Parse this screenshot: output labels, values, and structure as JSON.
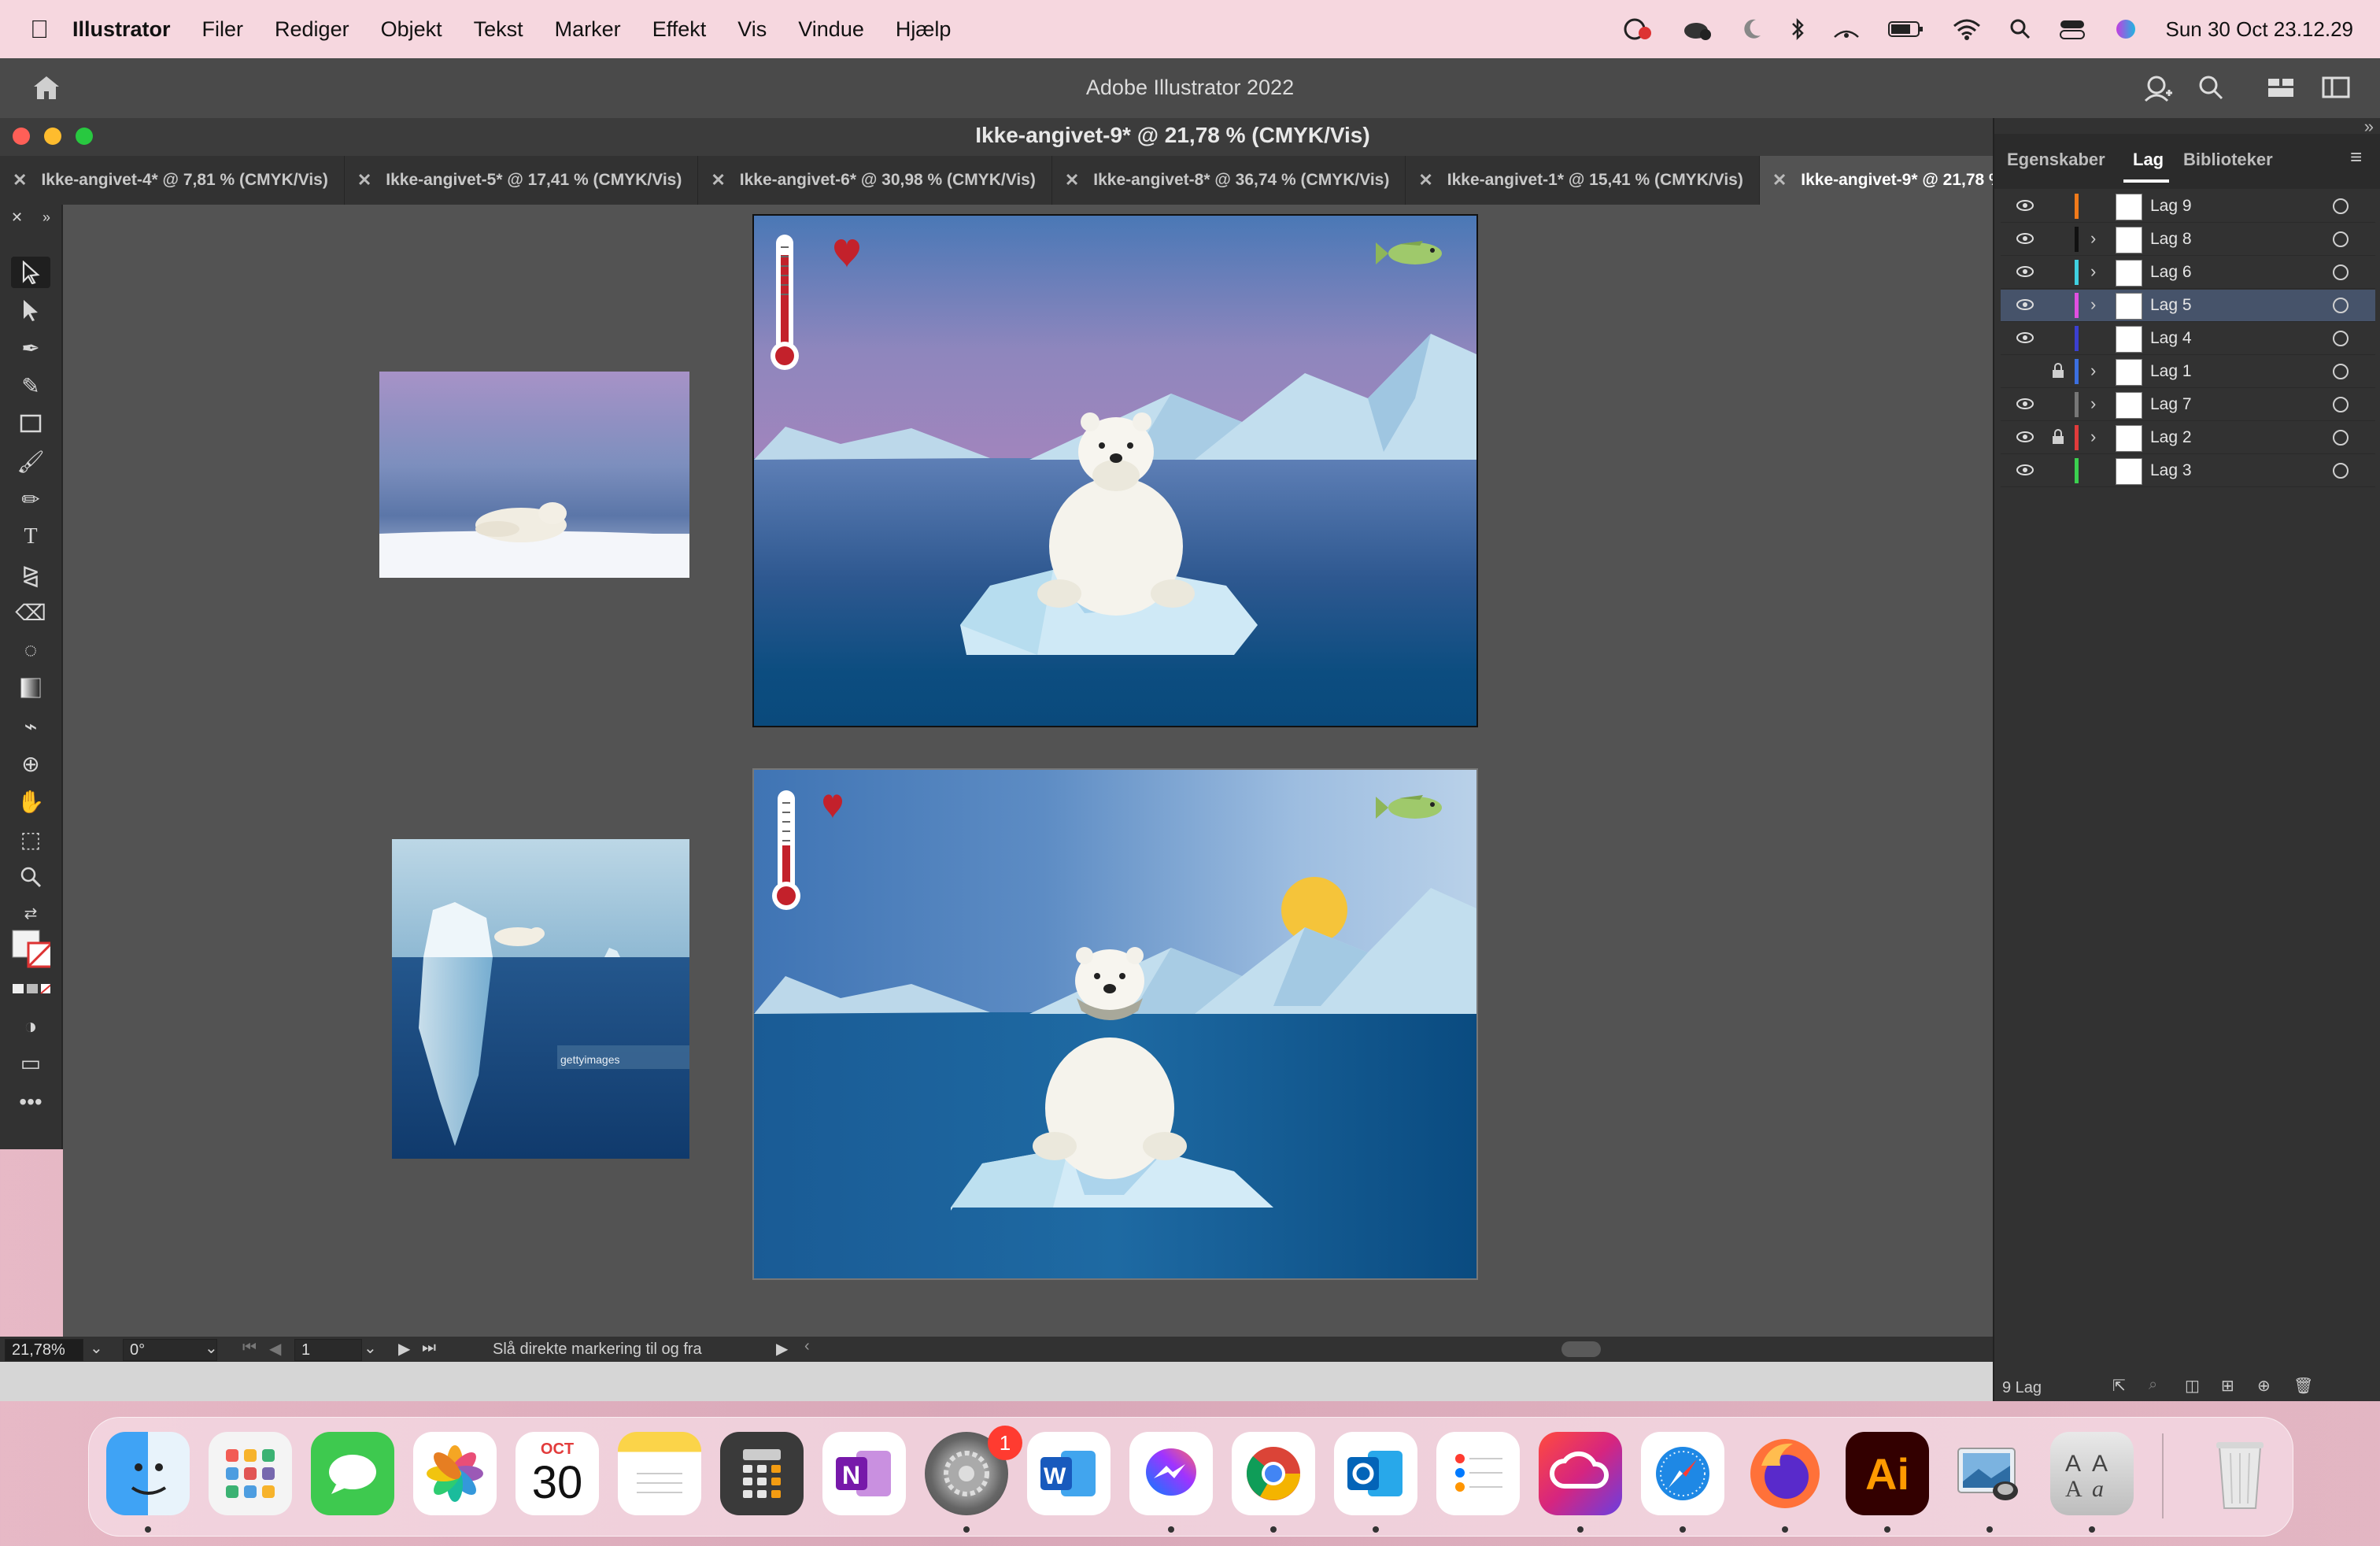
{
  "menubar": {
    "app_name": "Illustrator",
    "items": [
      "Filer",
      "Rediger",
      "Objekt",
      "Tekst",
      "Marker",
      "Effekt",
      "Vis",
      "Vindue",
      "Hjælp"
    ],
    "clock": "Sun 30 Oct  23.12.29"
  },
  "window": {
    "app_title": "Adobe Illustrator 2022",
    "doc_title": "Ikke-angivet-9* @ 21,78 % (CMYK/Vis)"
  },
  "tabs": [
    {
      "label": "Ikke-angivet-4* @ 7,81 % (CMYK/Vis)"
    },
    {
      "label": "Ikke-angivet-5* @ 17,41 % (CMYK/Vis)"
    },
    {
      "label": "Ikke-angivet-6* @ 30,98 % (CMYK/Vis)"
    },
    {
      "label": "Ikke-angivet-8* @ 36,74 % (CMYK/Vis)"
    },
    {
      "label": "Ikke-angivet-1* @ 15,41 % (CMYK/Vis)"
    },
    {
      "label": "Ikke-angivet-9* @ 21,78 % (CMYK/Vis)"
    }
  ],
  "panel": {
    "tabs": [
      "Egenskaber",
      "Lag",
      "Biblioteker"
    ],
    "active_tab": "Lag",
    "layers": [
      {
        "name": "Lag 9",
        "color": "#f07a1a",
        "visible": true,
        "locked": false,
        "expandable": false,
        "selected": false
      },
      {
        "name": "Lag 8",
        "color": "#111111",
        "visible": true,
        "locked": false,
        "expandable": true,
        "selected": false
      },
      {
        "name": "Lag 6",
        "color": "#3fd0e0",
        "visible": true,
        "locked": false,
        "expandable": true,
        "selected": false
      },
      {
        "name": "Lag 5",
        "color": "#e04fe0",
        "visible": true,
        "locked": false,
        "expandable": true,
        "selected": true
      },
      {
        "name": "Lag 4",
        "color": "#3b3fd0",
        "visible": true,
        "locked": false,
        "expandable": false,
        "selected": false
      },
      {
        "name": "Lag 1",
        "color": "#3b6fe0",
        "visible": false,
        "locked": true,
        "expandable": true,
        "selected": false
      },
      {
        "name": "Lag 7",
        "color": "#777777",
        "visible": true,
        "locked": false,
        "expandable": true,
        "selected": false
      },
      {
        "name": "Lag 2",
        "color": "#e03b3b",
        "visible": true,
        "locked": true,
        "expandable": true,
        "selected": false
      },
      {
        "name": "Lag 3",
        "color": "#3bd04f",
        "visible": true,
        "locked": false,
        "expandable": false,
        "selected": false
      }
    ],
    "layer_count": "9 Lag"
  },
  "status": {
    "zoom": "21,78%",
    "rotation": "0°",
    "artboard": "1",
    "hint": "Slå direkte markering til og fra"
  },
  "artwork": {
    "stock_watermark": "gettyimages"
  },
  "dock": {
    "calendar_month": "OCT",
    "calendar_day": "30",
    "settings_badge": "1",
    "illustrator_label": "Ai"
  }
}
